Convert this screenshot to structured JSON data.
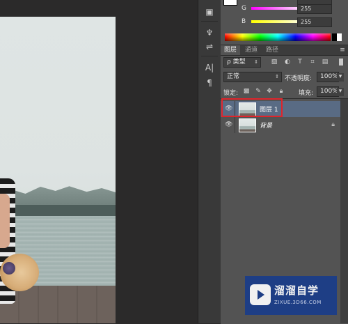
{
  "color_panel": {
    "channels": [
      {
        "label": "G",
        "value": "255",
        "gradient": [
          "#ff00ff",
          "#ffffff"
        ]
      },
      {
        "label": "B",
        "value": "255",
        "gradient": [
          "#ffff00",
          "#ffffff"
        ]
      }
    ],
    "top_value": ""
  },
  "layers_panel": {
    "tabs": [
      "图层",
      "通道",
      "路径"
    ],
    "active_tab": "图层",
    "filter_label": "ρ 类型",
    "blend_mode": "正常",
    "opacity_label": "不透明度:",
    "opacity_value": "100%",
    "lock_label": "锁定:",
    "fill_label": "填充:",
    "fill_value": "100%",
    "layers": [
      {
        "name": "图层 1",
        "selected": true,
        "visible": true,
        "locked": false
      },
      {
        "name": "背景",
        "selected": false,
        "visible": true,
        "locked": true
      }
    ]
  },
  "tool_icons": [
    "navigator-icon",
    "brush-preset-icon",
    "sliders-icon",
    "character-icon",
    "paragraph-icon"
  ],
  "watermark": {
    "title": "溜溜自学",
    "url": "ZIXUE.3D66.COM"
  },
  "colors": {
    "selection_highlight": "#e0242a",
    "selected_row": "#596b84",
    "watermark_bg": "#1a3d8a"
  }
}
